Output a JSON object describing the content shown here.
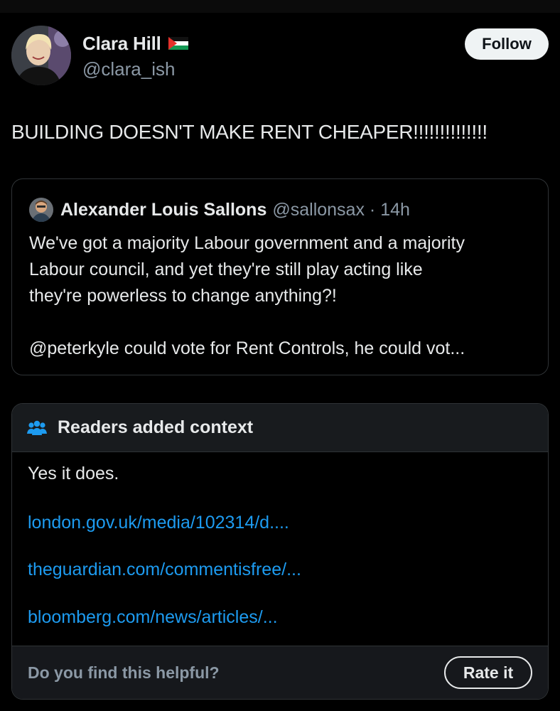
{
  "author": {
    "display_name": "Clara Hill",
    "handle": "@clara_ish",
    "flag_icon": "palestine-flag-icon"
  },
  "follow_label": "Follow",
  "post": {
    "text": "BUILDING DOESN'T MAKE RENT CHEAPER!!!!!!!!!!!!!!"
  },
  "quoted_post": {
    "name": "Alexander Louis Sallons",
    "handle": "@sallonsax",
    "separator": " · ",
    "time": "14h",
    "lines": [
      "We've got a majority Labour government and a majority",
      "Labour council, and yet they're still play acting like",
      "they're powerless to change anything?!"
    ],
    "truncated_line": "@peterkyle could vote for Rent Controls, he could vot..."
  },
  "community_note": {
    "title": "Readers added context",
    "icon": "people-icon",
    "body": "Yes it does.",
    "links": [
      "london.gov.uk/media/102314/d....",
      "theguardian.com/commentisfree/...",
      "bloomberg.com/news/articles/..."
    ],
    "helpful_prompt": "Do you find this helpful?",
    "rate_label": "Rate it"
  },
  "colors": {
    "background": "#000000",
    "text": "#e7e9ea",
    "secondary": "#8b98a5",
    "link": "#1d9bf0",
    "border": "#2f3336"
  }
}
